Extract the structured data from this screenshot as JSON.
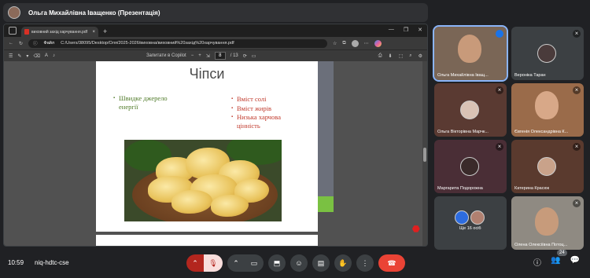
{
  "presenter_bar": {
    "title": "Ольга Михайлівна Іващенко (Презентація)"
  },
  "browser": {
    "tab_title": "виховний захід харчування.pdf",
    "new_tab": "+",
    "window_controls": [
      "—",
      "❐",
      "✕"
    ],
    "url_prefix": "Файл",
    "url": "C:/Users/38095/Desktop/Оля/2025-2026/виховна/виховний%20захід%20харчування.pdf"
  },
  "pdf_toolbar": {
    "ask_copilot": "Запитати в Copilot",
    "zoom_out": "−",
    "zoom_in": "+",
    "page_current": "8",
    "page_total": "/ 13"
  },
  "slide": {
    "title": "Чіпси",
    "left_bullets": [
      "Швидке джерело енергії"
    ],
    "right_bullets": [
      "Вміст солі",
      "Вміст жирів",
      "Низька харчова цінність"
    ]
  },
  "participants": [
    {
      "name": "Ольга Михайлівна Іващ...",
      "muted": false,
      "video": true,
      "speaking": true
    },
    {
      "name": "Вероніка Таран",
      "muted": true,
      "video": false
    },
    {
      "name": "Ольга Вікторівна Марчк...",
      "muted": true,
      "video": false
    },
    {
      "name": "Євгенія Олександрівна К...",
      "muted": true,
      "video": true
    },
    {
      "name": "Маргарита Подорожна",
      "muted": true,
      "video": false
    },
    {
      "name": "Катерина Красюк",
      "muted": true,
      "video": false
    },
    {
      "name": "Ще 16 осіб",
      "muted": false,
      "video": false
    },
    {
      "name": "Олена Олексіївна Потоц...",
      "muted": true,
      "video": true
    }
  ],
  "bottom_bar": {
    "time": "10:59",
    "meeting_code": "niq-hdtc-cse",
    "participant_count": "24"
  },
  "colors": {
    "accent": "#8ab4f8",
    "end_call": "#ea4335",
    "mic_off_bg": "#f9dedc"
  }
}
